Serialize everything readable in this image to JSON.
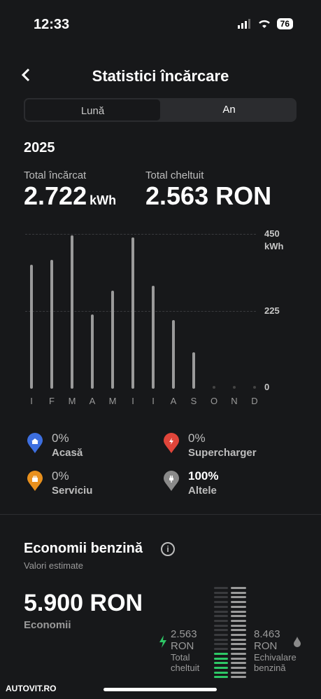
{
  "status": {
    "time": "12:33",
    "battery": "76"
  },
  "header": {
    "title": "Statistici încărcare"
  },
  "tabs": [
    {
      "label": "Lună",
      "active": false
    },
    {
      "label": "An",
      "active": true
    }
  ],
  "year": "2025",
  "summary": {
    "charged_label": "Total încărcat",
    "charged_value": "2.722",
    "charged_unit": "kWh",
    "spent_label": "Total cheltuit",
    "spent_value": "2.563 RON"
  },
  "chart_data": {
    "type": "bar",
    "categories": [
      "I",
      "F",
      "M",
      "A",
      "M",
      "I",
      "I",
      "A",
      "S",
      "O",
      "N",
      "D"
    ],
    "values": [
      360,
      375,
      445,
      215,
      285,
      440,
      300,
      200,
      105,
      0,
      0,
      0
    ],
    "ylim": [
      0,
      450
    ],
    "yticks": [
      "450",
      "225",
      "0"
    ],
    "yunit": "kWh"
  },
  "legend": [
    {
      "pct": "0%",
      "name": "Acasă",
      "color": "#3d6fe0",
      "icon": "home-icon"
    },
    {
      "pct": "0%",
      "name": "Supercharger",
      "color": "#e0453a",
      "icon": "bolt-icon"
    },
    {
      "pct": "0%",
      "name": "Serviciu",
      "color": "#e8901d",
      "icon": "briefcase-icon"
    },
    {
      "pct": "100%",
      "name": "Altele",
      "color": "#8a8a8a",
      "icon": "plug-icon"
    }
  ],
  "savings": {
    "title": "Economii benzină",
    "subtitle": "Valori estimate",
    "value": "5.900 RON",
    "value_label": "Economii",
    "spent_num": "2.563",
    "spent_unit": "RON",
    "spent_l1": "Total",
    "spent_l2": "cheltuit",
    "fuel_num": "8.463",
    "fuel_unit": "RON",
    "fuel_l1": "Echivalare",
    "fuel_l2": "benzină",
    "gauge_fill": 0.3
  },
  "watermark": "AUTOVIT.RO"
}
